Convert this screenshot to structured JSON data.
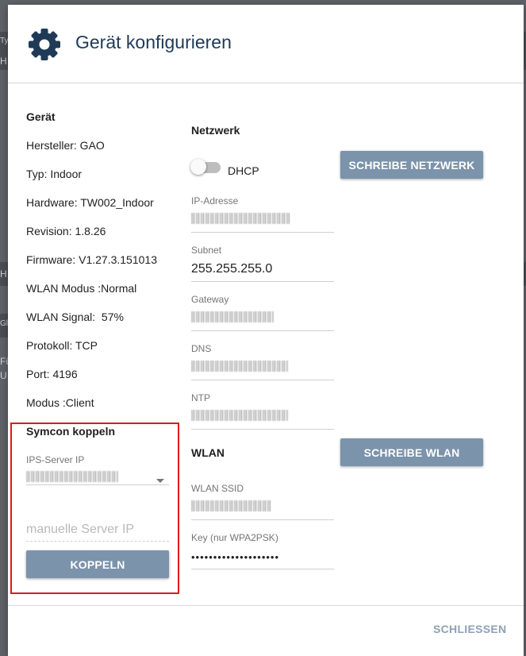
{
  "dialog": {
    "title": "Gerät konfigurieren",
    "icon": "gear-icon",
    "close_label": "SCHLIESSEN"
  },
  "device": {
    "heading": "Gerät",
    "rows": [
      "Hersteller: GAO",
      "Typ: Indoor",
      "Hardware: TW002_Indoor",
      "Revision: 1.8.26",
      "Firmware: V1.27.3.151013",
      "WLAN Modus :Normal",
      "WLAN Signal:  57%",
      "Protokoll: TCP",
      "Port: 4196",
      "Modus :Client"
    ]
  },
  "symcon": {
    "heading": "Symcon koppeln",
    "server_ip_label": "IPS-Server IP",
    "manual_placeholder": "manuelle Server IP",
    "couple_label": "KOPPELN"
  },
  "network": {
    "heading": "Netzwerk",
    "dhcp_label": "DHCP",
    "dhcp_enabled": false,
    "write_label": "SCHREIBE NETZWERK",
    "fields": {
      "ip": {
        "label": "IP-Adresse"
      },
      "subnet": {
        "label": "Subnet",
        "value": "255.255.255.0"
      },
      "gateway": {
        "label": "Gateway"
      },
      "dns": {
        "label": "DNS"
      },
      "ntp": {
        "label": "NTP"
      }
    }
  },
  "wlan": {
    "heading": "WLAN",
    "write_label": "SCHREIBE WLAN",
    "ssid_label": "WLAN SSID",
    "key_label": "Key (nur WPA2PSK)",
    "key_value": "••••••••••••••••••••"
  },
  "background": {
    "fragments": [
      "Ty",
      "H",
      "H",
      "Gl",
      "Fü",
      "U"
    ]
  },
  "colors": {
    "button": "#7b93ab",
    "title": "#1e3a57",
    "highlight": "#e0191f"
  }
}
